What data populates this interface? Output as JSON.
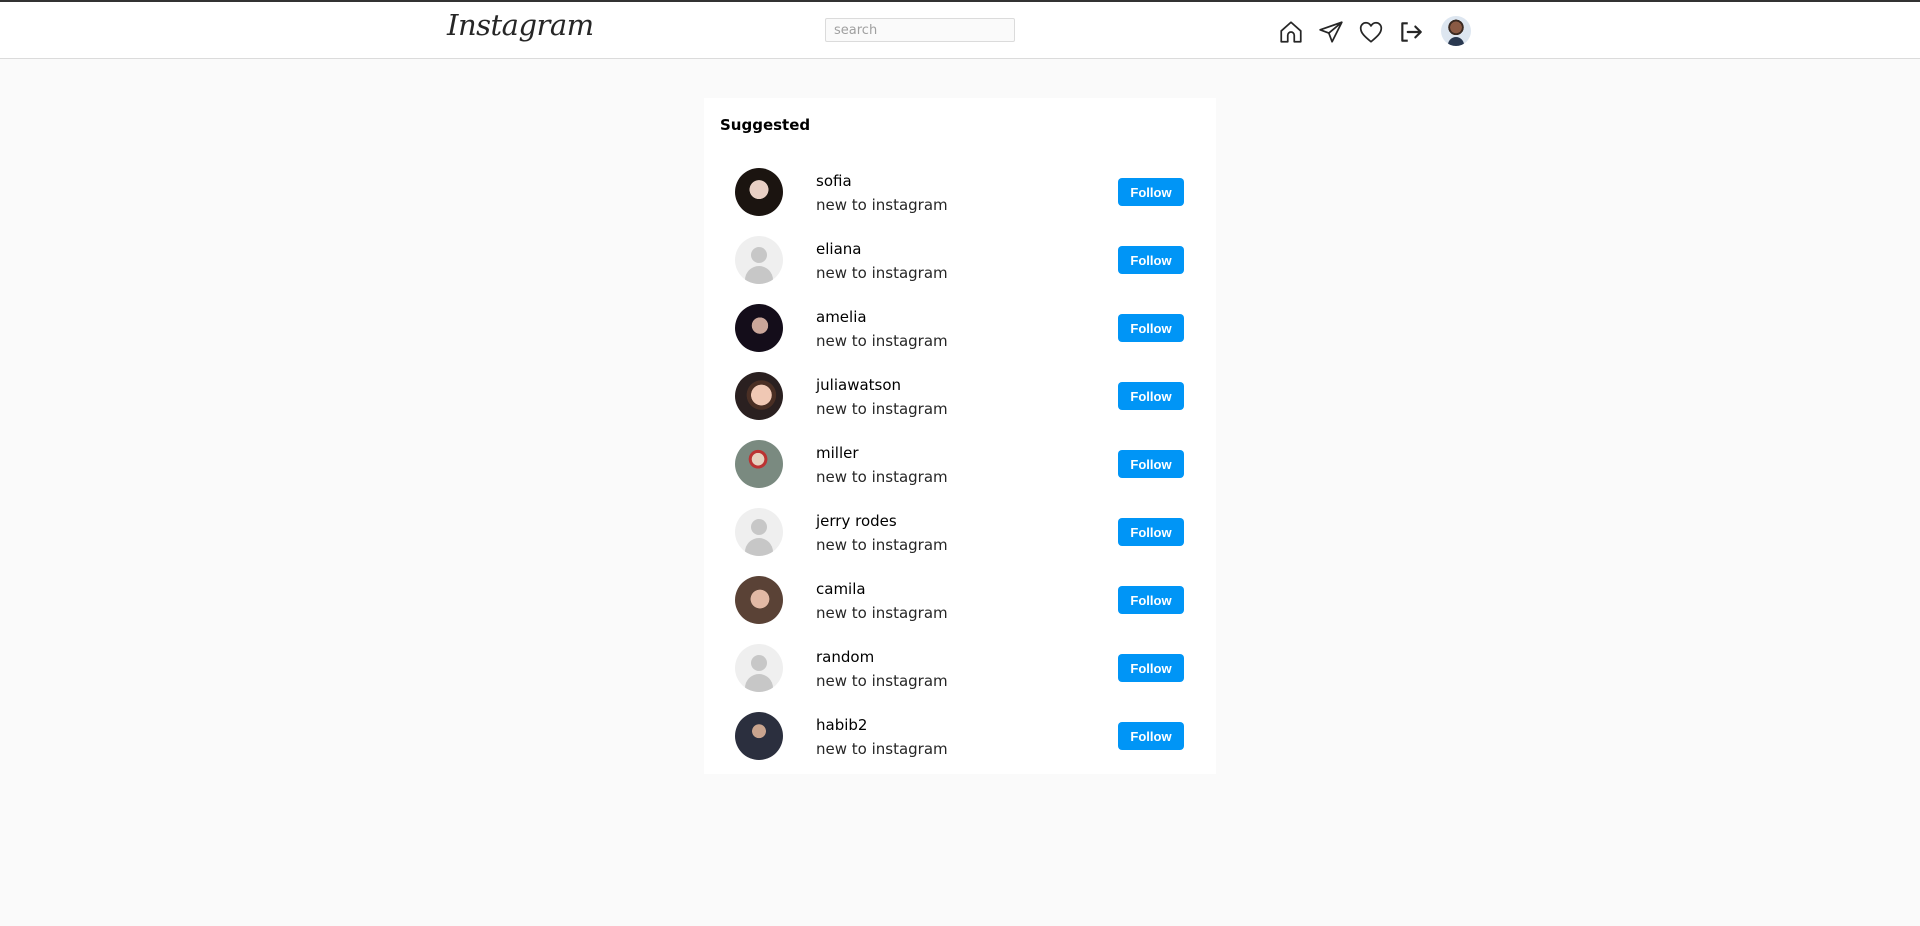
{
  "app": {
    "logo_text": "Instagram"
  },
  "search": {
    "placeholder": "search",
    "value": ""
  },
  "nav": {
    "icons": [
      "home-icon",
      "direct-send-icon",
      "heart-icon",
      "logout-icon",
      "profile-avatar"
    ]
  },
  "suggested": {
    "title": "Suggested",
    "follow_label": "Follow",
    "users": [
      {
        "username": "sofia",
        "subtitle": "new to instagram",
        "avatar": "photo"
      },
      {
        "username": "eliana",
        "subtitle": "new to instagram",
        "avatar": "default"
      },
      {
        "username": "amelia",
        "subtitle": "new to instagram",
        "avatar": "photo"
      },
      {
        "username": "juliawatson",
        "subtitle": "new to instagram",
        "avatar": "photo"
      },
      {
        "username": "miller",
        "subtitle": "new to instagram",
        "avatar": "photo"
      },
      {
        "username": "jerry rodes",
        "subtitle": "new to instagram",
        "avatar": "default"
      },
      {
        "username": "camila",
        "subtitle": "new to instagram",
        "avatar": "photo"
      },
      {
        "username": "random",
        "subtitle": "new to instagram",
        "avatar": "default"
      },
      {
        "username": "habib2",
        "subtitle": "new to instagram",
        "avatar": "photo"
      }
    ]
  },
  "colors": {
    "follow_button": "#0095f6",
    "page_background": "#fafafa",
    "panel_background": "#ffffff"
  }
}
